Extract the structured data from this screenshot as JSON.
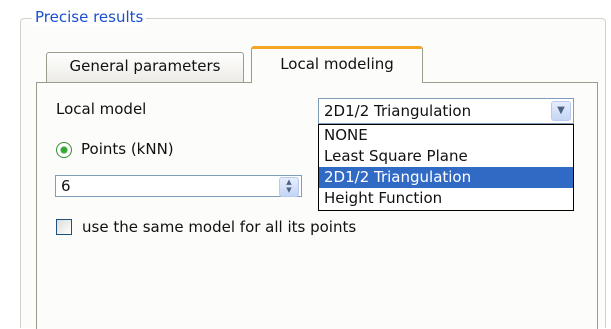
{
  "group": {
    "title": "Precise results"
  },
  "tabs": [
    {
      "label": "General parameters",
      "active": false
    },
    {
      "label": "Local modeling",
      "active": true
    }
  ],
  "local_model": {
    "label": "Local model",
    "selected": "2D1/2 Triangulation",
    "options": [
      "NONE",
      "Least Square Plane",
      "2D1/2 Triangulation",
      "Height Function"
    ],
    "dropdown_open": true
  },
  "neighborhood": {
    "radio_label": "Points (kNN)",
    "radio_checked": true,
    "value": "6"
  },
  "same_model": {
    "label": "use the same model for all its points",
    "checked": false
  },
  "icons": {
    "dropdown_arrow": "chevron-down-icon",
    "spinner": "spinner-arrows-icon"
  },
  "colors": {
    "group_title": "#1b4fd1",
    "active_tab_accent": "#f5a623",
    "selection_highlight": "#316ac5",
    "radio_dot": "#36a836"
  }
}
